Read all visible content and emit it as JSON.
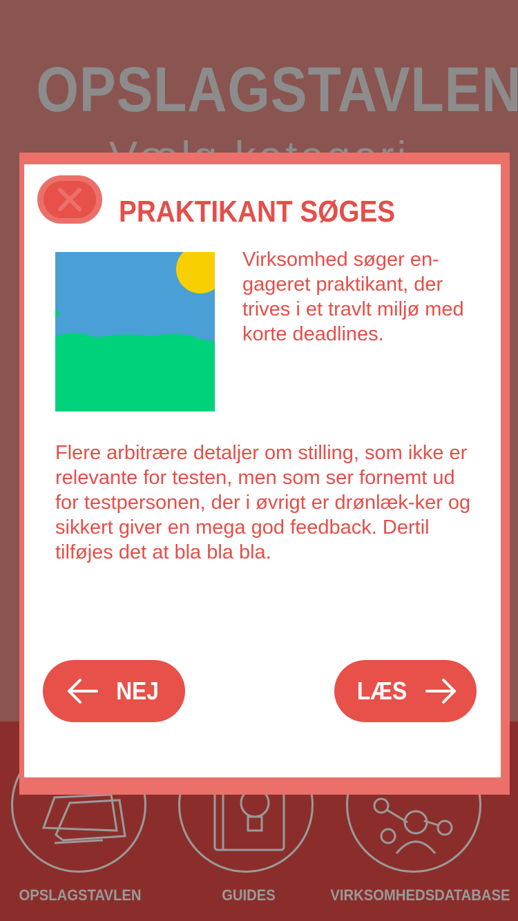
{
  "app": {
    "title": "OPSLAGSTAVLEN",
    "subtitle": "Vælg kategori"
  },
  "modal": {
    "close_icon": "close-x-icon",
    "title": "PRAKTIKANT SØGES",
    "image_icon": "placeholder-landscape-image",
    "description": "Virksomhed søger en-gageret praktikant, der trives i et travlt miljø med korte deadlines.",
    "details": "Flere arbitrære detaljer om stilling, som ikke er relevante for testen, men som ser fornemt ud for testpersonen, der i øvrigt er drønlæk-ker og sikkert giver en mega god feedback. Dertil tilføjes det at bla bla bla.",
    "reject_button": {
      "label": "NEJ",
      "icon": "arrow-left-icon"
    },
    "read_button": {
      "label": "LÆS",
      "icon": "arrow-right-icon"
    }
  },
  "nav": {
    "items": [
      {
        "label": "OPSLAGSTAVLEN",
        "icon": "notes-icon"
      },
      {
        "label": "GUIDES",
        "icon": "book-lightbulb-icon"
      },
      {
        "label": "VIRKSOMHEDSDATABASE",
        "icon": "network-person-icon"
      }
    ]
  },
  "colors": {
    "accent": "#e8504a",
    "accent_light": "#ec706a",
    "overlay_top": "#8a5450",
    "overlay_bottom": "#8b2e2b",
    "muted_gray": "#8c8c8c"
  }
}
